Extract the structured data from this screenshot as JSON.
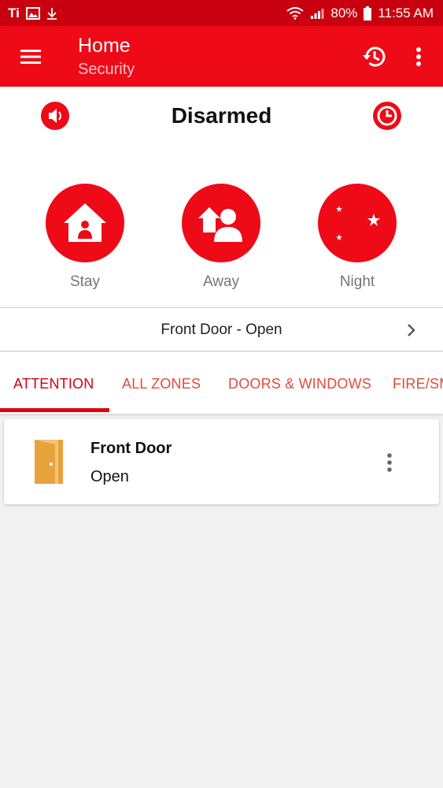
{
  "status_bar": {
    "left_glyphs": [
      "Ti",
      "image-icon",
      "download-icon"
    ],
    "battery_percent": "80%",
    "time": "11:55 AM"
  },
  "app_bar": {
    "title": "Home",
    "subtitle": "Security",
    "icons": [
      "menu-icon",
      "history-icon",
      "more-vert-icon"
    ]
  },
  "security": {
    "arm_status": "Disarmed",
    "modes": [
      {
        "label": "Stay",
        "icon": "home-person-icon"
      },
      {
        "label": "Away",
        "icon": "away-person-icon"
      },
      {
        "label": "Night",
        "icon": "moon-stars-icon"
      }
    ]
  },
  "zone_summary": {
    "text": "Front Door - Open"
  },
  "tabs": [
    {
      "label": "ATTENTION",
      "active": true
    },
    {
      "label": "ALL ZONES",
      "active": false
    },
    {
      "label": "DOORS & WINDOWS",
      "active": false
    },
    {
      "label": "FIRE/SMOKE",
      "active": false
    }
  ],
  "zones": [
    {
      "name": "Front Door",
      "state": "Open",
      "icon": "door-open-icon"
    }
  ],
  "colors": {
    "status_bar": "#c8000f",
    "app_bar": "#ee0a17",
    "accent": "#ee0a17",
    "door_icon": "#e8a23c"
  }
}
